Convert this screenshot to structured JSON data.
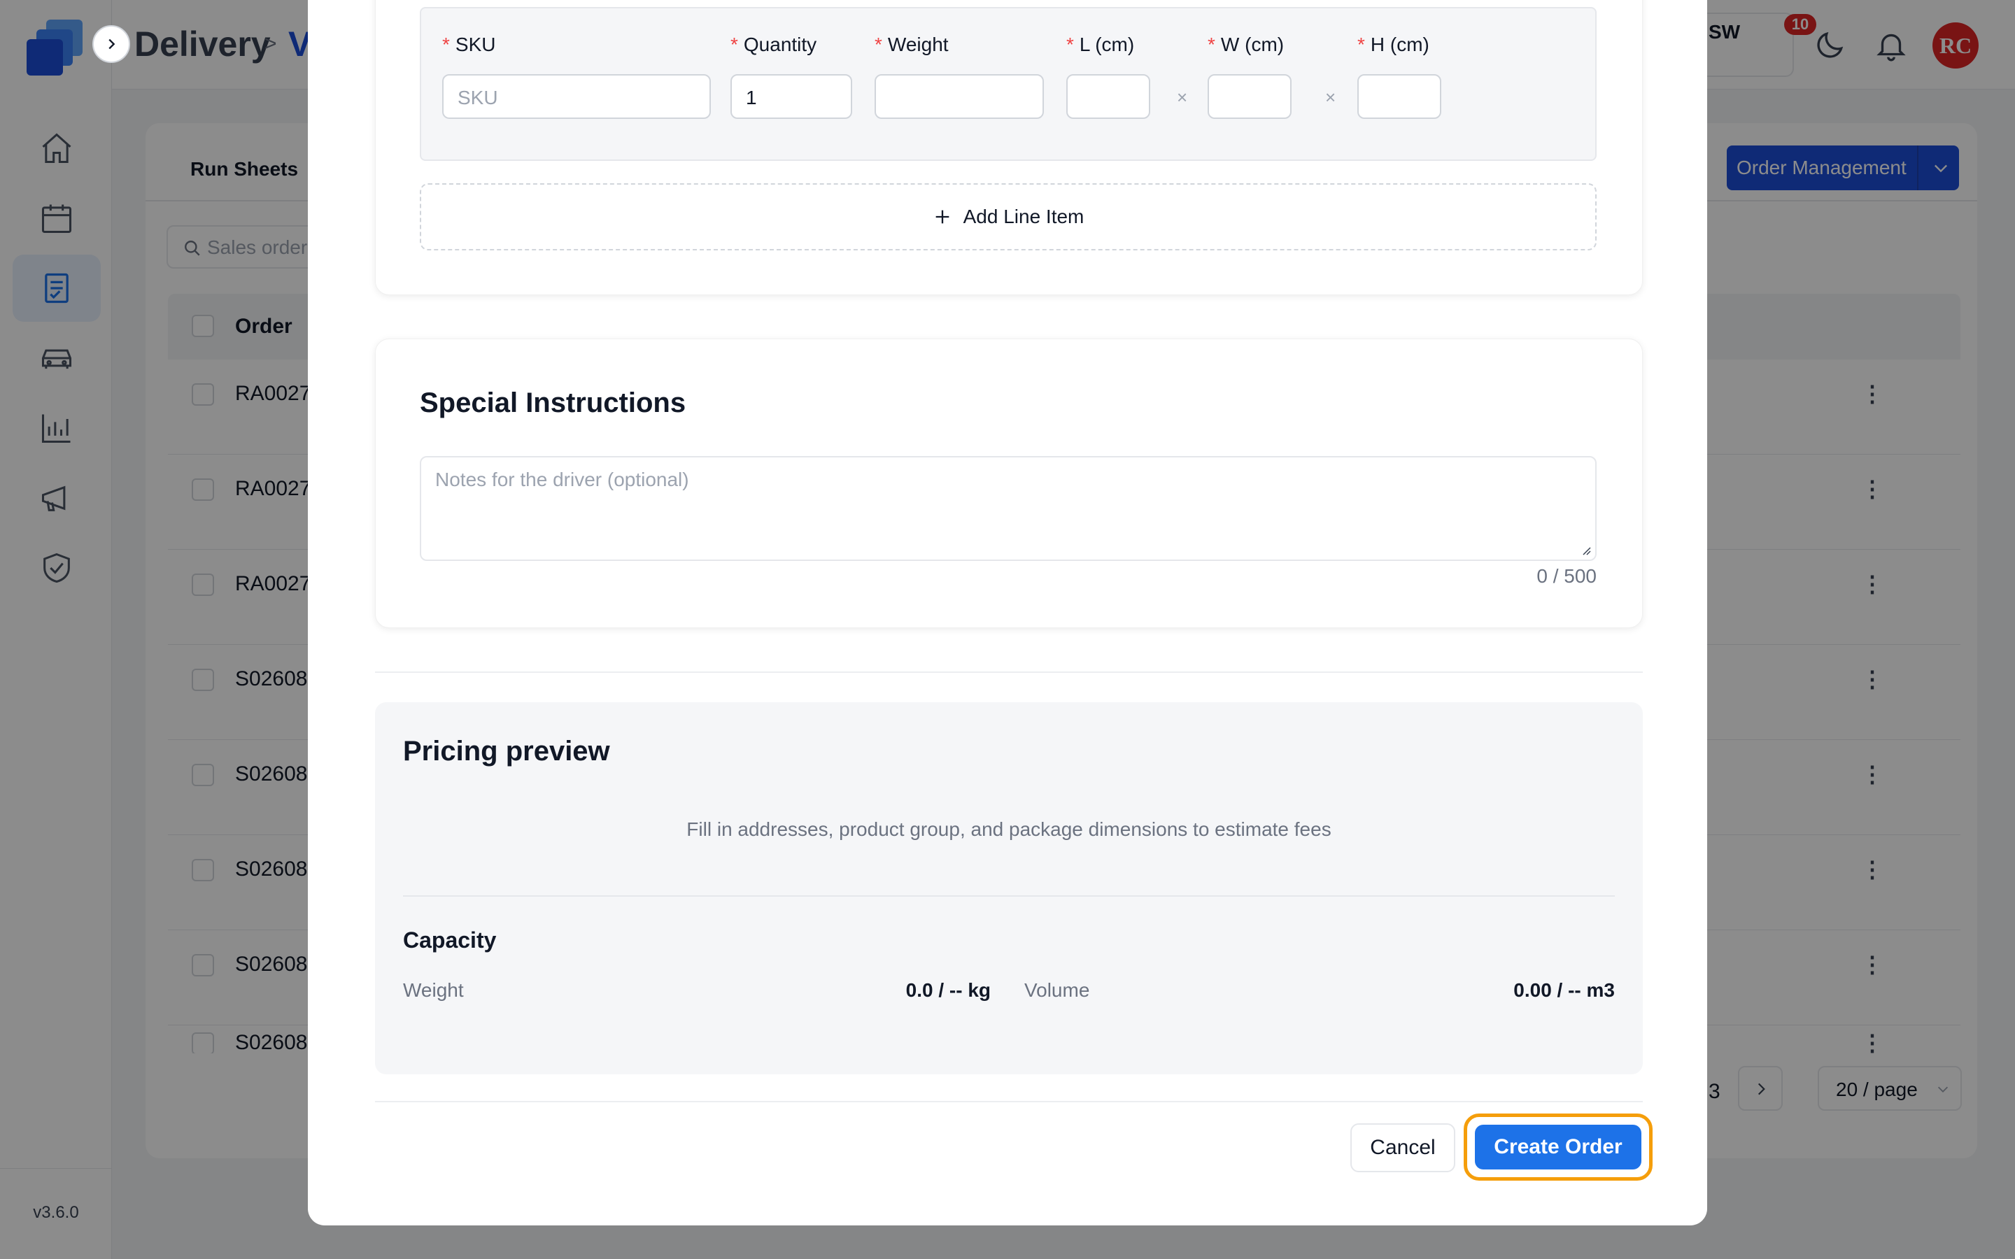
{
  "app": {
    "version": "v3.6.0"
  },
  "header": {
    "breadcrumb_root": "Delivery",
    "breadcrumb_sep": ">",
    "breadcrumb_current": "V",
    "tenant_label": "SW",
    "notification_count": "10",
    "avatar_initials": "RC"
  },
  "sidebar": {
    "items": [
      {
        "name": "home",
        "icon": "home-icon",
        "active": false
      },
      {
        "name": "calendar",
        "icon": "calendar-icon",
        "active": false
      },
      {
        "name": "orders",
        "icon": "document-list-icon",
        "active": true
      },
      {
        "name": "vehicles",
        "icon": "car-icon",
        "active": false
      },
      {
        "name": "reports",
        "icon": "bar-chart-icon",
        "active": false
      },
      {
        "name": "announcements",
        "icon": "megaphone-icon",
        "active": false
      },
      {
        "name": "compliance",
        "icon": "shield-check-icon",
        "active": false
      }
    ]
  },
  "background": {
    "tab_label": "Run Sheets",
    "search_placeholder": "Sales order",
    "order_management_label": "Order Management",
    "table_header_order": "Order",
    "rows": [
      "RA0027",
      "RA0027",
      "RA0027",
      "S02608",
      "S02608",
      "S02608",
      "S02608",
      "S02608"
    ],
    "row_action": "⋮",
    "pager_page": "3",
    "page_size": "20 / page"
  },
  "modal": {
    "line_item": {
      "sku_label": "SKU",
      "sku_placeholder": "SKU",
      "quantity_label": "Quantity",
      "quantity_value": "1",
      "weight_label": "Weight",
      "l_label": "L (cm)",
      "w_label": "W (cm)",
      "h_label": "H (cm)",
      "required_mark": "*",
      "times": "×"
    },
    "add_line_item": "Add Line Item",
    "special_instructions": {
      "title": "Special Instructions",
      "placeholder": "Notes for the driver (optional)",
      "counter": "0 / 500"
    },
    "pricing": {
      "title": "Pricing preview",
      "hint": "Fill in addresses, product group, and package dimensions to estimate fees",
      "capacity_title": "Capacity",
      "weight_label": "Weight",
      "weight_value": "0.0 / -- kg",
      "volume_label": "Volume",
      "volume_value": "0.00 / -- m3"
    },
    "cancel_label": "Cancel",
    "create_label": "Create Order"
  },
  "colors": {
    "primary": "#1d72e8",
    "focus_ring": "#f59e0b",
    "required": "#ef4444",
    "badge": "#dc2626"
  }
}
